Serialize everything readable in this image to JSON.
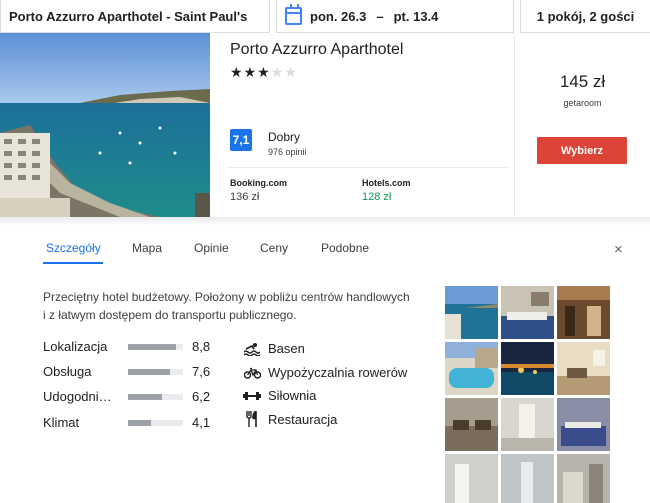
{
  "search": {
    "hotel_query": "Porto Azzurro Aparthotel - Saint Paul's",
    "checkin": "pon. 26.3",
    "dash": "–",
    "checkout": "pt. 13.4",
    "guests": "1 pokój, 2 gości"
  },
  "hotel": {
    "name": "Porto Azzurro Aparthotel",
    "stars": 3,
    "max_stars": 5,
    "rating": "7,1",
    "rating_word": "Dobry",
    "reviews": "976 opinii",
    "offers": [
      {
        "name": "Booking.com",
        "price": "136 zł",
        "highlight": false
      },
      {
        "name": "Hotels.com",
        "price": "128 zł",
        "highlight": true
      }
    ],
    "best_price": "145 zł",
    "best_provider": "getaroom",
    "select_label": "Wybierz"
  },
  "tabs": [
    "Szczegóły",
    "Mapa",
    "Opinie",
    "Ceny",
    "Podobne"
  ],
  "active_tab": 0,
  "close_symbol": "×",
  "description": "Przeciętny hotel budżetowy. Położony w pobliżu centrów handlowych i z łatwym dostępem do transportu publicznego.",
  "scores": [
    {
      "label": "Lokalizacja",
      "value": "8,8",
      "fraction": 0.88
    },
    {
      "label": "Obsługa",
      "value": "7,6",
      "fraction": 0.76
    },
    {
      "label": "Udogodni…",
      "value": "6,2",
      "fraction": 0.62
    },
    {
      "label": "Klimat",
      "value": "4,1",
      "fraction": 0.41
    }
  ],
  "amenities": [
    {
      "label": "Basen",
      "icon": "pool-icon"
    },
    {
      "label": "Wypożyczalnia rowerów",
      "icon": "bicycle-icon"
    },
    {
      "label": "Siłownia",
      "icon": "dumbbell-icon"
    },
    {
      "label": "Restauracja",
      "icon": "restaurant-icon"
    }
  ],
  "colors": {
    "accent": "#1a73e8",
    "select_button": "#db4437",
    "price_highlight": "#0f9d58"
  }
}
